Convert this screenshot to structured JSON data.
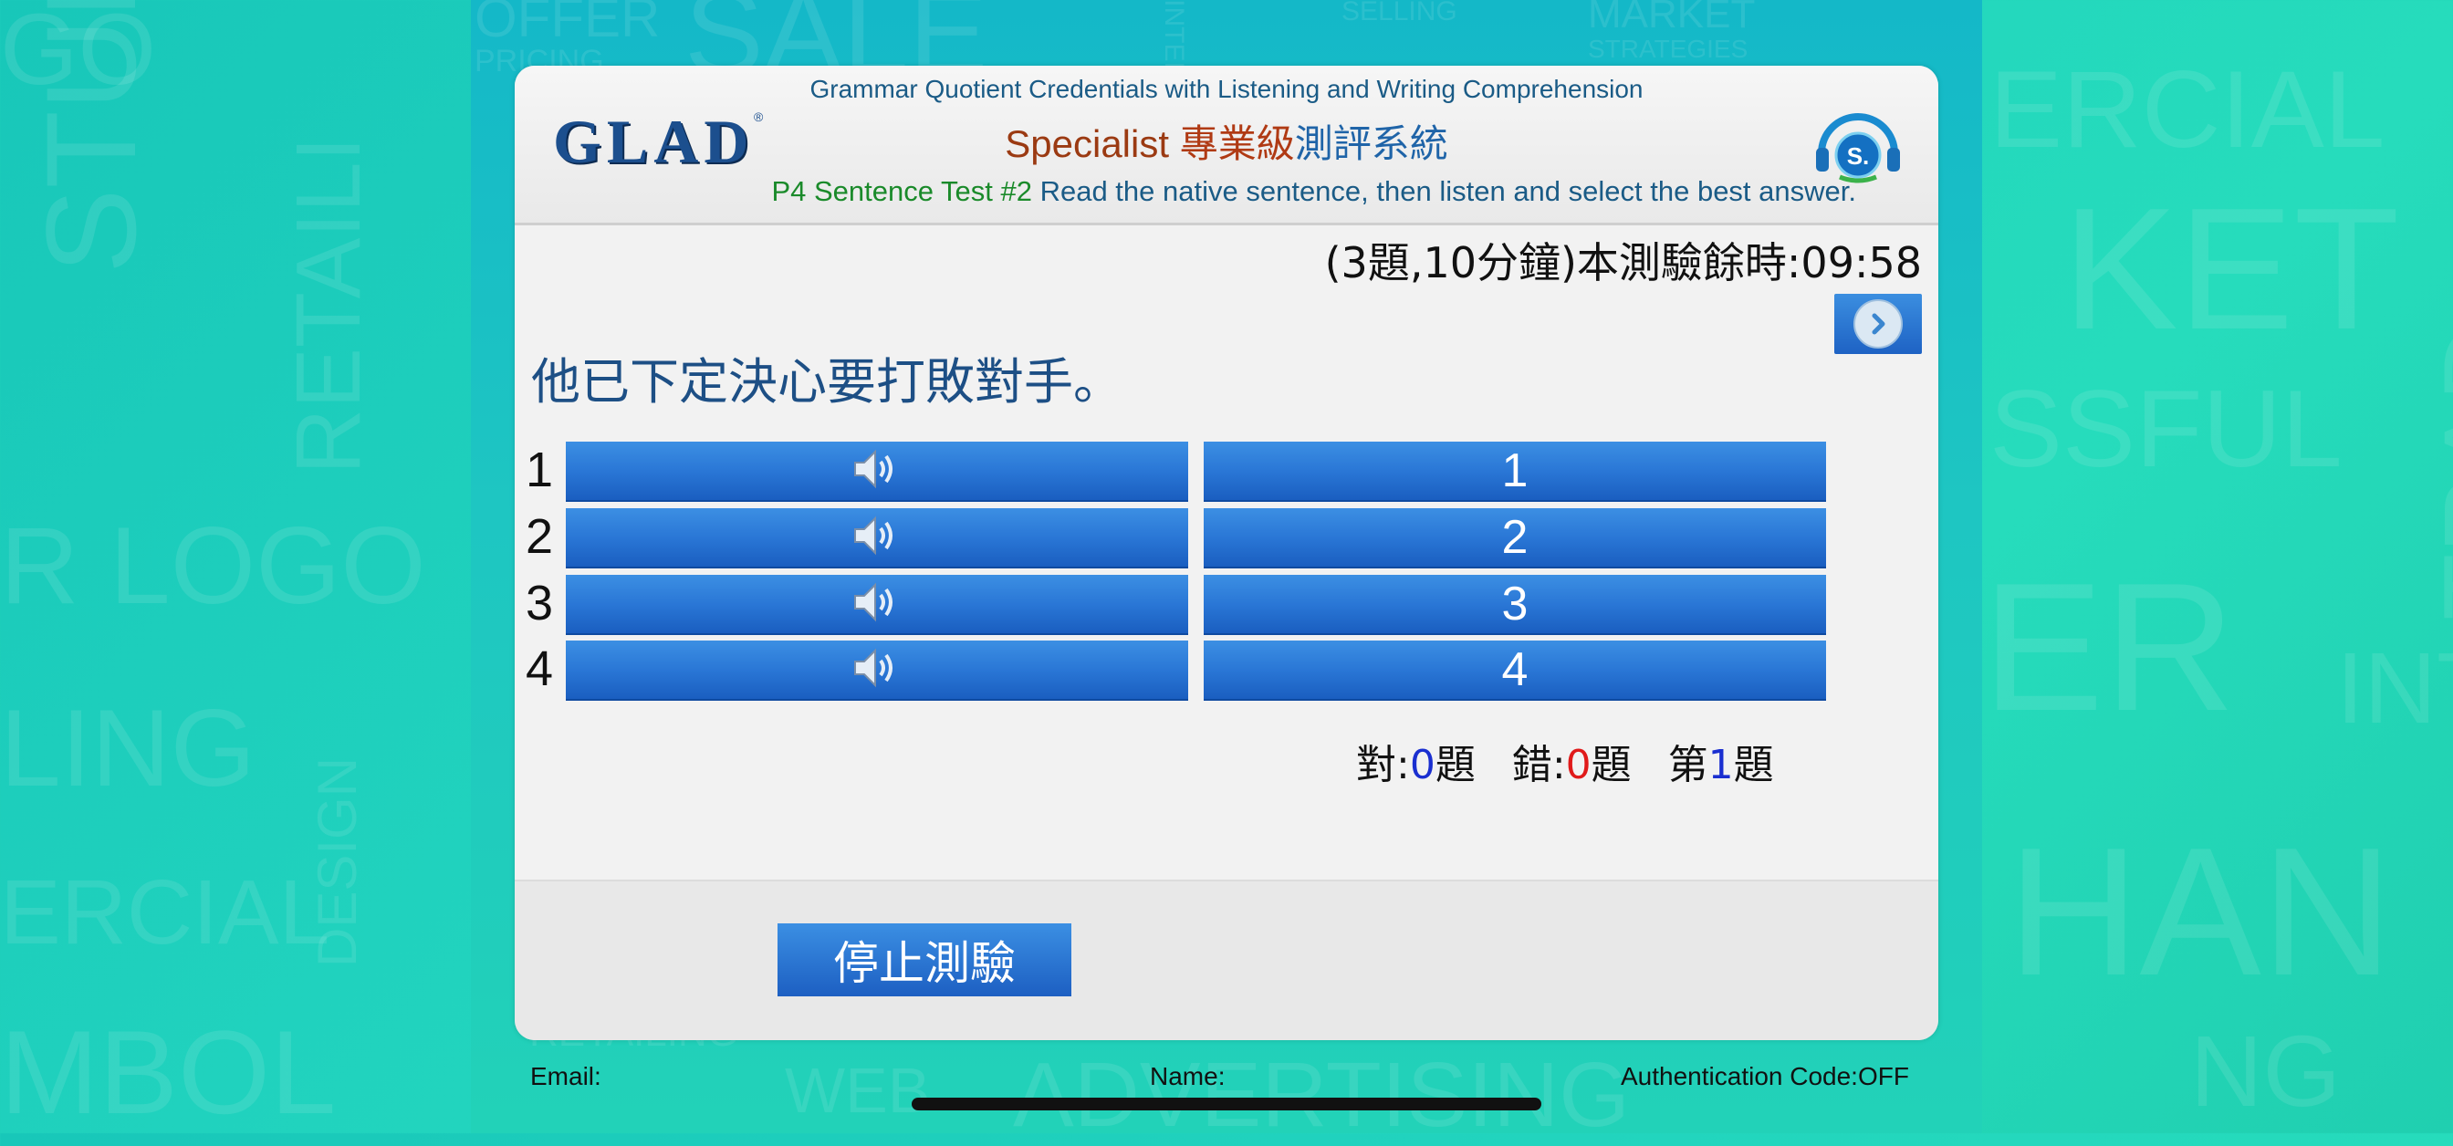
{
  "header": {
    "logo": "GLAD",
    "logo_reg": "®",
    "subtitle": "Grammar Quotient Credentials with Listening and Writing Comprehension",
    "title_specialist": "Specialist ",
    "title_cn_level": "專業級",
    "title_cn_system": "測評系統",
    "test_name": "P4 Sentence Test #2",
    "instruction": " Read the native sentence, then listen and select the best answer.",
    "headset_letter": "S."
  },
  "timer": "(3題,10分鐘)本測驗餘時:09:58",
  "question": "他已下定決心要打敗對手。",
  "options": [
    {
      "number": "1",
      "answer_label": "1"
    },
    {
      "number": "2",
      "answer_label": "2"
    },
    {
      "number": "3",
      "answer_label": "3"
    },
    {
      "number": "4",
      "answer_label": "4"
    }
  ],
  "score": {
    "correct_label": "對:",
    "correct_value": "0",
    "correct_unit": "題",
    "wrong_label": "錯:",
    "wrong_value": "0",
    "wrong_unit": "題",
    "current_prefix": "第",
    "current_value": "1",
    "current_unit": "題"
  },
  "stop_button": "停止測驗",
  "footer": {
    "email_label": "Email:",
    "name_label": "Name:",
    "auth_label": "Authentication Code:OFF"
  },
  "background_words": [
    "GO",
    "OFFER",
    "SALE",
    "MARKET",
    "STRATEGIES",
    "PRICING",
    "SELLING",
    "INTERN",
    "STUDY",
    "RETAILI",
    "ERCIAL",
    "KET",
    "SSFUL",
    "TRAD",
    "ER",
    "INT",
    "R LOGO",
    "LING",
    "ERCIAL",
    "DESIGN",
    "MBOL",
    "RETAILING",
    "WEB",
    "ADVERTISING",
    "HAN",
    "NG"
  ],
  "colors": {
    "button_blue": "#2a77d6",
    "question_text": "#1d4f85",
    "test_name_green": "#1a8a2a",
    "score_blue": "#1a2fd0",
    "score_red": "#e01a1a"
  }
}
